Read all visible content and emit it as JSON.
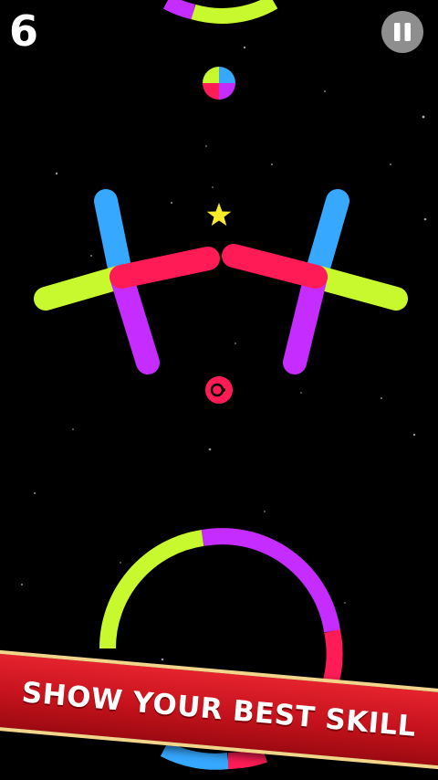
{
  "hud": {
    "score": "6",
    "pause_icon": "pause-icon"
  },
  "banner": {
    "text": "SHOW YOUR BEST SKILL"
  },
  "game_colors": {
    "cyan": "#36a8ff",
    "yellow": "#c8f92e",
    "magenta": "#c52cff",
    "pink": "#ff1c56",
    "star": "#f8ec2a",
    "background": "#000000"
  },
  "objects": {
    "player_ball_color": "pink",
    "star_icon": "star-icon",
    "color_switcher_icon": "color-switcher-icon"
  }
}
